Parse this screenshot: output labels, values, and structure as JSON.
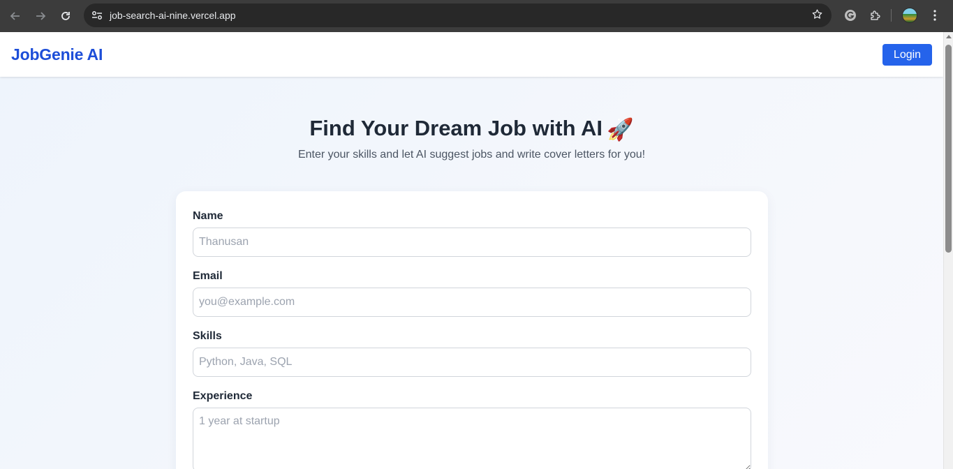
{
  "browser": {
    "url": "job-search-ai-nine.vercel.app",
    "icons": {
      "back": "arrow-left-icon",
      "forward": "arrow-right-icon",
      "reload": "reload-icon",
      "site_info": "tune-icon",
      "bookmark": "star-icon",
      "grammarly": "grammarly-icon",
      "extensions": "puzzle-icon",
      "profile": "avatar",
      "menu": "kebab-menu-icon"
    }
  },
  "header": {
    "brand": "JobGenie AI",
    "login_label": "Login"
  },
  "hero": {
    "title": "Find Your Dream Job with AI",
    "rocket": "🚀",
    "subtitle": "Enter your skills and let AI suggest jobs and write cover letters for you!"
  },
  "form": {
    "name": {
      "label": "Name",
      "placeholder": "Thanusan",
      "value": ""
    },
    "email": {
      "label": "Email",
      "placeholder": "you@example.com",
      "value": ""
    },
    "skills": {
      "label": "Skills",
      "placeholder": "Python, Java, SQL",
      "value": ""
    },
    "experience": {
      "label": "Experience",
      "placeholder": "1 year at startup",
      "value": ""
    }
  },
  "colors": {
    "brand": "#1d4ed8",
    "primary_button": "#2563eb",
    "heading": "#1f2937",
    "subtext": "#4b5563",
    "placeholder": "#9ca3af"
  }
}
